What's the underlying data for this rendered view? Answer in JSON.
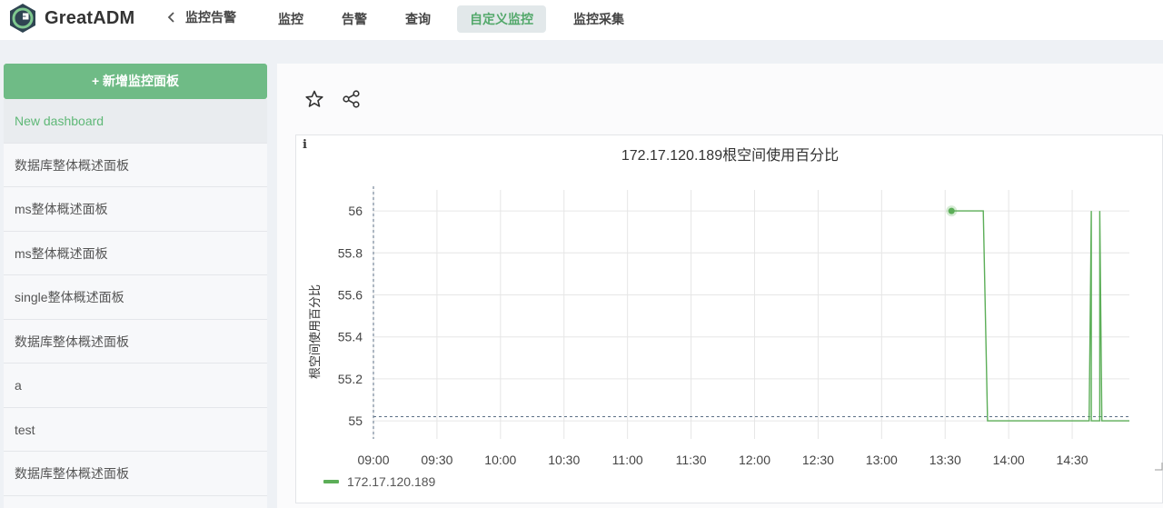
{
  "app": {
    "brand": "GreatADM"
  },
  "nav": {
    "back_label": "监控告警",
    "items": [
      {
        "label": "监控"
      },
      {
        "label": "告警"
      },
      {
        "label": "查询"
      },
      {
        "label": "自定义监控"
      },
      {
        "label": "监控采集"
      }
    ],
    "active": "自定义监控"
  },
  "sidebar": {
    "add_button": "+ 新增监控面板",
    "items": [
      {
        "label": "New dashboard"
      },
      {
        "label": "数据库整体概述面板"
      },
      {
        "label": "ms整体概述面板"
      },
      {
        "label": "ms整体概述面板"
      },
      {
        "label": "single整体概述面板"
      },
      {
        "label": "数据库整体概述面板"
      },
      {
        "label": "a"
      },
      {
        "label": "test"
      },
      {
        "label": "数据库整体概述面板"
      }
    ],
    "active_index": 0
  },
  "toolbar": {
    "icons": [
      "star-icon",
      "share-icon"
    ]
  },
  "panel": {
    "info_icon": "i",
    "title": "172.17.120.189根空间使用百分比",
    "ylabel": "根空间使用百分比",
    "legend": "172.17.120.189"
  },
  "colors": {
    "accent": "#6fbb86",
    "series": "#5cae58",
    "active_text": "#52a86a"
  },
  "chart_data": {
    "type": "line",
    "title": "172.17.120.189根空间使用百分比",
    "xlabel": "",
    "ylabel": "根空间使用百分比",
    "x_ticks": [
      "09:00",
      "09:30",
      "10:00",
      "10:30",
      "11:00",
      "11:30",
      "12:00",
      "12:30",
      "13:00",
      "13:30",
      "14:00",
      "14:30"
    ],
    "y_ticks": [
      55,
      55.2,
      55.4,
      55.6,
      55.8,
      56
    ],
    "xlim": [
      "09:00",
      "14:57"
    ],
    "ylim": [
      54.94,
      56.1
    ],
    "grid": true,
    "legend_position": "bottom-left",
    "series": [
      {
        "name": "172.17.120.189",
        "points": [
          [
            "13:33",
            56
          ],
          [
            "13:48",
            56
          ],
          [
            "13:50",
            55
          ],
          [
            "14:38",
            55
          ],
          [
            "14:39",
            56
          ],
          [
            "14:39",
            55
          ],
          [
            "14:43",
            55
          ],
          [
            "14:43",
            56
          ],
          [
            "14:44",
            55
          ],
          [
            "14:57",
            55
          ]
        ]
      }
    ],
    "reference_lines": [
      {
        "axis": "x",
        "value": "09:00"
      },
      {
        "axis": "y",
        "value": 55.02
      }
    ]
  }
}
